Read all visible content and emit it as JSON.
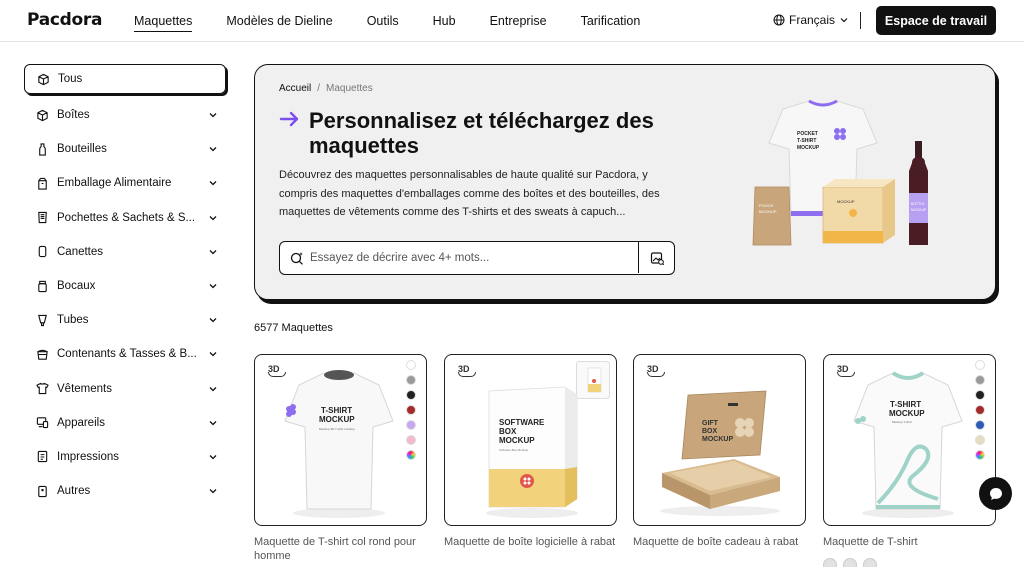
{
  "header": {
    "logo": "Pacdora",
    "nav": [
      "Maquettes",
      "Modèles de Dieline",
      "Outils",
      "Hub",
      "Entreprise",
      "Tarification"
    ],
    "language": "Français",
    "workspace_button": "Espace de travail"
  },
  "sidebar": {
    "items": [
      {
        "label": "Tous",
        "icon": "box-icon",
        "active": true
      },
      {
        "label": "Boîtes",
        "icon": "box-icon"
      },
      {
        "label": "Bouteilles",
        "icon": "bottle-icon"
      },
      {
        "label": "Emballage Alimentaire",
        "icon": "food-pack-icon"
      },
      {
        "label": "Pochettes & Sachets & S...",
        "icon": "pouch-icon"
      },
      {
        "label": "Canettes",
        "icon": "can-icon"
      },
      {
        "label": "Bocaux",
        "icon": "jar-icon"
      },
      {
        "label": "Tubes",
        "icon": "tube-icon"
      },
      {
        "label": "Contenants & Tasses & B...",
        "icon": "bowl-icon"
      },
      {
        "label": "Vêtements",
        "icon": "shirt-icon"
      },
      {
        "label": "Appareils",
        "icon": "device-icon"
      },
      {
        "label": "Impressions",
        "icon": "print-icon"
      },
      {
        "label": "Autres",
        "icon": "other-icon"
      }
    ]
  },
  "hero": {
    "breadcrumb": {
      "home": "Accueil",
      "separator": "/",
      "current": "Maquettes"
    },
    "title": "Personnalisez et téléchargez des maquettes",
    "description": "Découvrez des maquettes personnalisables de haute qualité sur Pacdora, y compris des maquettes d'emballages comme des boîtes et des bouteilles, des maquettes de vêtements comme des T-shirts et des sweats à capuch...",
    "search_placeholder": "Essayez de décrire avec 4+ mots...",
    "art": {
      "shirt_text": [
        "POCKET",
        "T-SHIRT",
        "MOCKUP"
      ],
      "pouch_text": [
        "POUCH",
        "MOCKUP"
      ],
      "box_text": "MOCKUP",
      "bottle_text": [
        "BOTTLE",
        "MOCKUP"
      ]
    }
  },
  "results": {
    "count_label": "6577 Maquettes"
  },
  "cards": [
    {
      "title": "Maquette de T-shirt col rond pour homme",
      "badge": "3D",
      "art_text": [
        "T-SHIRT",
        "MOCKUP"
      ],
      "art_sub": "Mockup 3D T-shirt mockup",
      "swatches": [
        "#ffffff",
        "#9a9a9a",
        "#222222",
        "#a52a2a",
        "#c9a7f0",
        "#f4b8d0",
        "conic"
      ]
    },
    {
      "title": "Maquette de boîte logicielle à rabat",
      "badge": "3D",
      "art_text": [
        "SOFTWARE",
        "BOX",
        "MOCKUP"
      ],
      "art_sub": "Software Box Mockup"
    },
    {
      "title": "Maquette de boîte cadeau à rabat",
      "badge": "3D",
      "art_text": [
        "GIFT",
        "BOX",
        "MOCKUP"
      ],
      "art_sub": "MOCKUP"
    },
    {
      "title": "Maquette de T-shirt",
      "badge": "3D",
      "art_text": [
        "T-SHIRT",
        "MOCKUP"
      ],
      "art_sub": "Mockup T-shirt",
      "swatches": [
        "#ffffff",
        "#9a9a9a",
        "#222222",
        "#a52a2a",
        "#2f5bb8",
        "#e8dcc0",
        "conic"
      ]
    }
  ],
  "colors": {
    "accent": "#7b4ff0",
    "dark": "#111111",
    "hero_bg": "#f0f0f0",
    "badge_red": "#e2574c",
    "box_yellow": "#f2d27a",
    "kraft": "#c8a57a"
  }
}
